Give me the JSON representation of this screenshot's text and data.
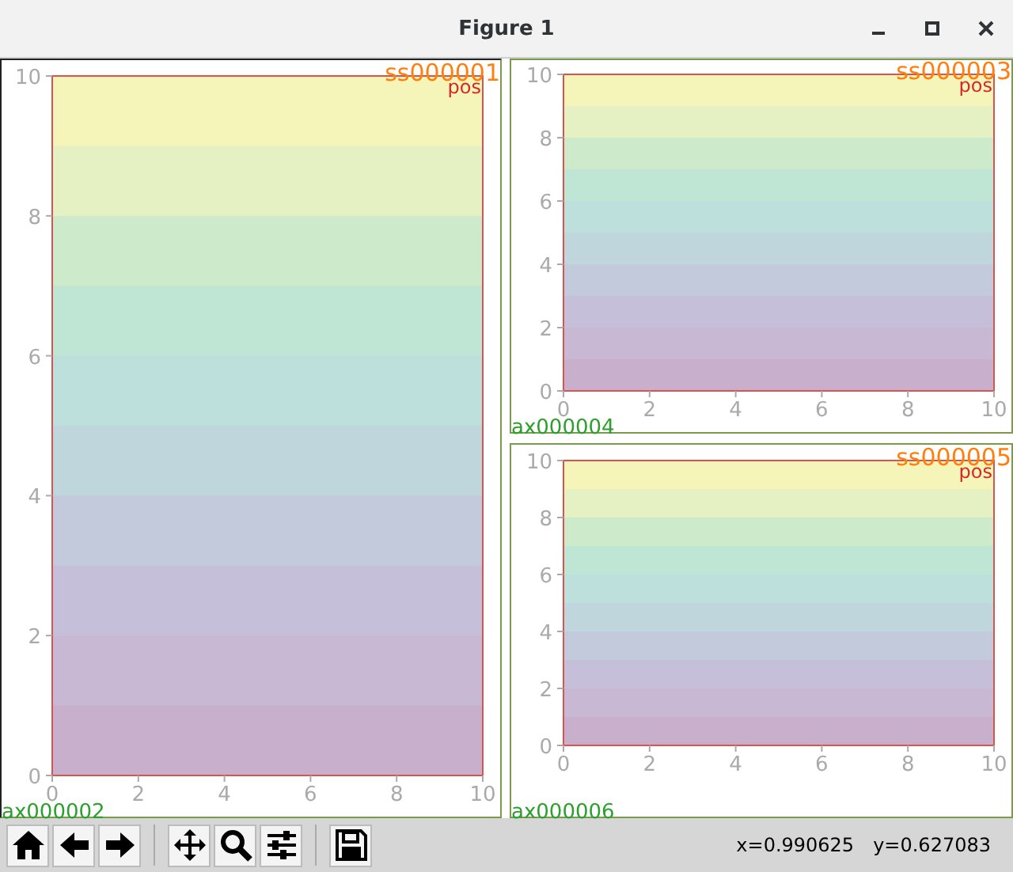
{
  "window": {
    "title": "Figure 1"
  },
  "panels": [
    {
      "subplot_label": "ss000001",
      "tag": "pos",
      "axes_label": "ax000002",
      "xticks": [
        "0",
        "2",
        "4",
        "6",
        "8",
        "10"
      ],
      "yticks": [
        "10",
        "8",
        "6",
        "4",
        "2",
        "0"
      ]
    },
    {
      "subplot_label": "ss000003",
      "tag": "pos",
      "axes_label": "ax000004",
      "xticks": [
        "0",
        "2",
        "4",
        "6",
        "8",
        "10"
      ],
      "yticks": [
        "10",
        "8",
        "6",
        "4",
        "2",
        "0"
      ]
    },
    {
      "subplot_label": "ss000005",
      "tag": "pos",
      "axes_label": "ax000006",
      "xticks": [
        "0",
        "2",
        "4",
        "6",
        "8",
        "10"
      ],
      "yticks": [
        "10",
        "8",
        "6",
        "4",
        "2",
        "0"
      ]
    }
  ],
  "status": {
    "x": "x=0.990625",
    "y": "y=0.627083"
  }
}
